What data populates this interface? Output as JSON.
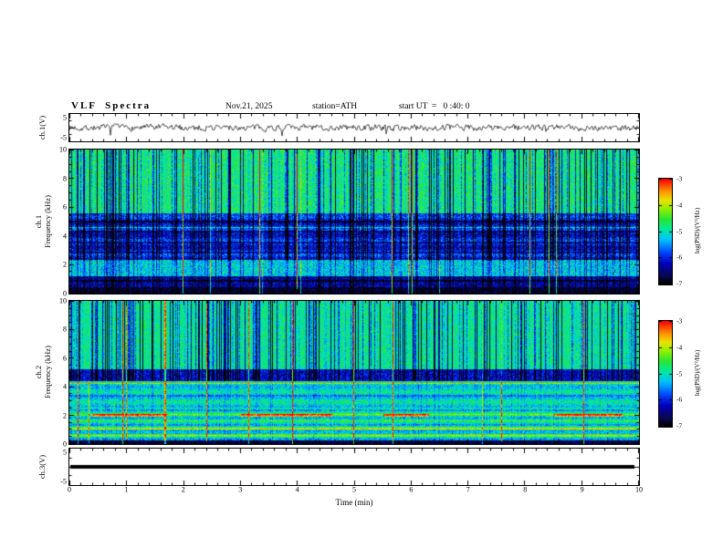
{
  "header": {
    "title": "VLF  Spectra",
    "date": "Nov.21, 2025",
    "station": "station=ATH",
    "start_ut": "start UT  =   0 :40: 0"
  },
  "chart_data": {
    "type": "heatmap",
    "title": "VLF Spectra",
    "colormap": "rainbow: black -> dark blue -> blue -> cyan -> green -> yellow -> red",
    "x": {
      "label": "Time  (min)",
      "range": [
        0,
        10
      ],
      "ticks": [
        0,
        1,
        2,
        3,
        4,
        5,
        6,
        7,
        8,
        9,
        10
      ],
      "minor_tick_step_min": 0.2
    },
    "panels": [
      {
        "name": "ch1-waveform",
        "type": "line",
        "ylabel": "ch.1(V)",
        "ylim": [
          -5,
          5
        ],
        "yticks": [
          5,
          -5
        ],
        "summary": "broadband noise trace around 0 V, mostly within ±1.5 V, intermittent spikes to about ±3 V over the full 10 minutes"
      },
      {
        "name": "ch1-spectrogram",
        "type": "heatmap",
        "ylabel": "ch.1 Frequency (kHz)",
        "ylabel_line1": "ch.1",
        "ylabel_line2": "Frequency (kHz)",
        "ylim": [
          0,
          10
        ],
        "yticks": [
          0,
          2,
          4,
          6,
          8,
          10
        ],
        "zlabel": "log(PSD)/(V²/Hz)",
        "zrange": [
          -7,
          -3
        ],
        "summary": "green background (~1e-5) above ~5.5 kHz with dense vertical dark-blue dropout stripes and sporadic yellow/red transient columns; blue band (~1e-6) between ~2.4 and 5.5 kHz with darker horizontal lines near 2.9, 3.6, 4.3 and 5.0 kHz; cyan-green band 1.3-2.3 kHz; very dark band below ~1 kHz"
      },
      {
        "name": "ch2-spectrogram",
        "type": "heatmap",
        "ylabel": "ch.2 Frequency (kHz)",
        "ylabel_line1": "ch.2",
        "ylabel_line2": "Frequency (kHz)",
        "ylim": [
          0,
          10
        ],
        "yticks": [
          0,
          2,
          4,
          6,
          8,
          10
        ],
        "zlabel": "log(PSD)/(V²/Hz)",
        "zrange": [
          -7,
          -3
        ],
        "summary": "green background (~1e-5) above ~5.2 kHz with vertical dark-blue dropout stripes; dark blue band 4.5-5.2 kHz; orange horizontal line near 4.3 kHz; layered green/yellow horizontal striping below 2.5 kHz with segmented red-brown dashes near 2.0 kHz; dark band below ~0.3 kHz"
      },
      {
        "name": "ch3-waveform",
        "type": "line",
        "ylabel": "ch.3(V)",
        "ylim": [
          -5,
          5
        ],
        "yticks": [
          5,
          -5
        ],
        "summary": "flat thick black trace at 0 V for the whole interval (no signal)"
      }
    ],
    "colorbar": {
      "label": "log(PSD)/(V²/Hz)",
      "ticks": [
        -3,
        -4,
        -5,
        -6,
        -7
      ],
      "top_value": -3,
      "bottom_value": -7,
      "instances": 2
    }
  }
}
